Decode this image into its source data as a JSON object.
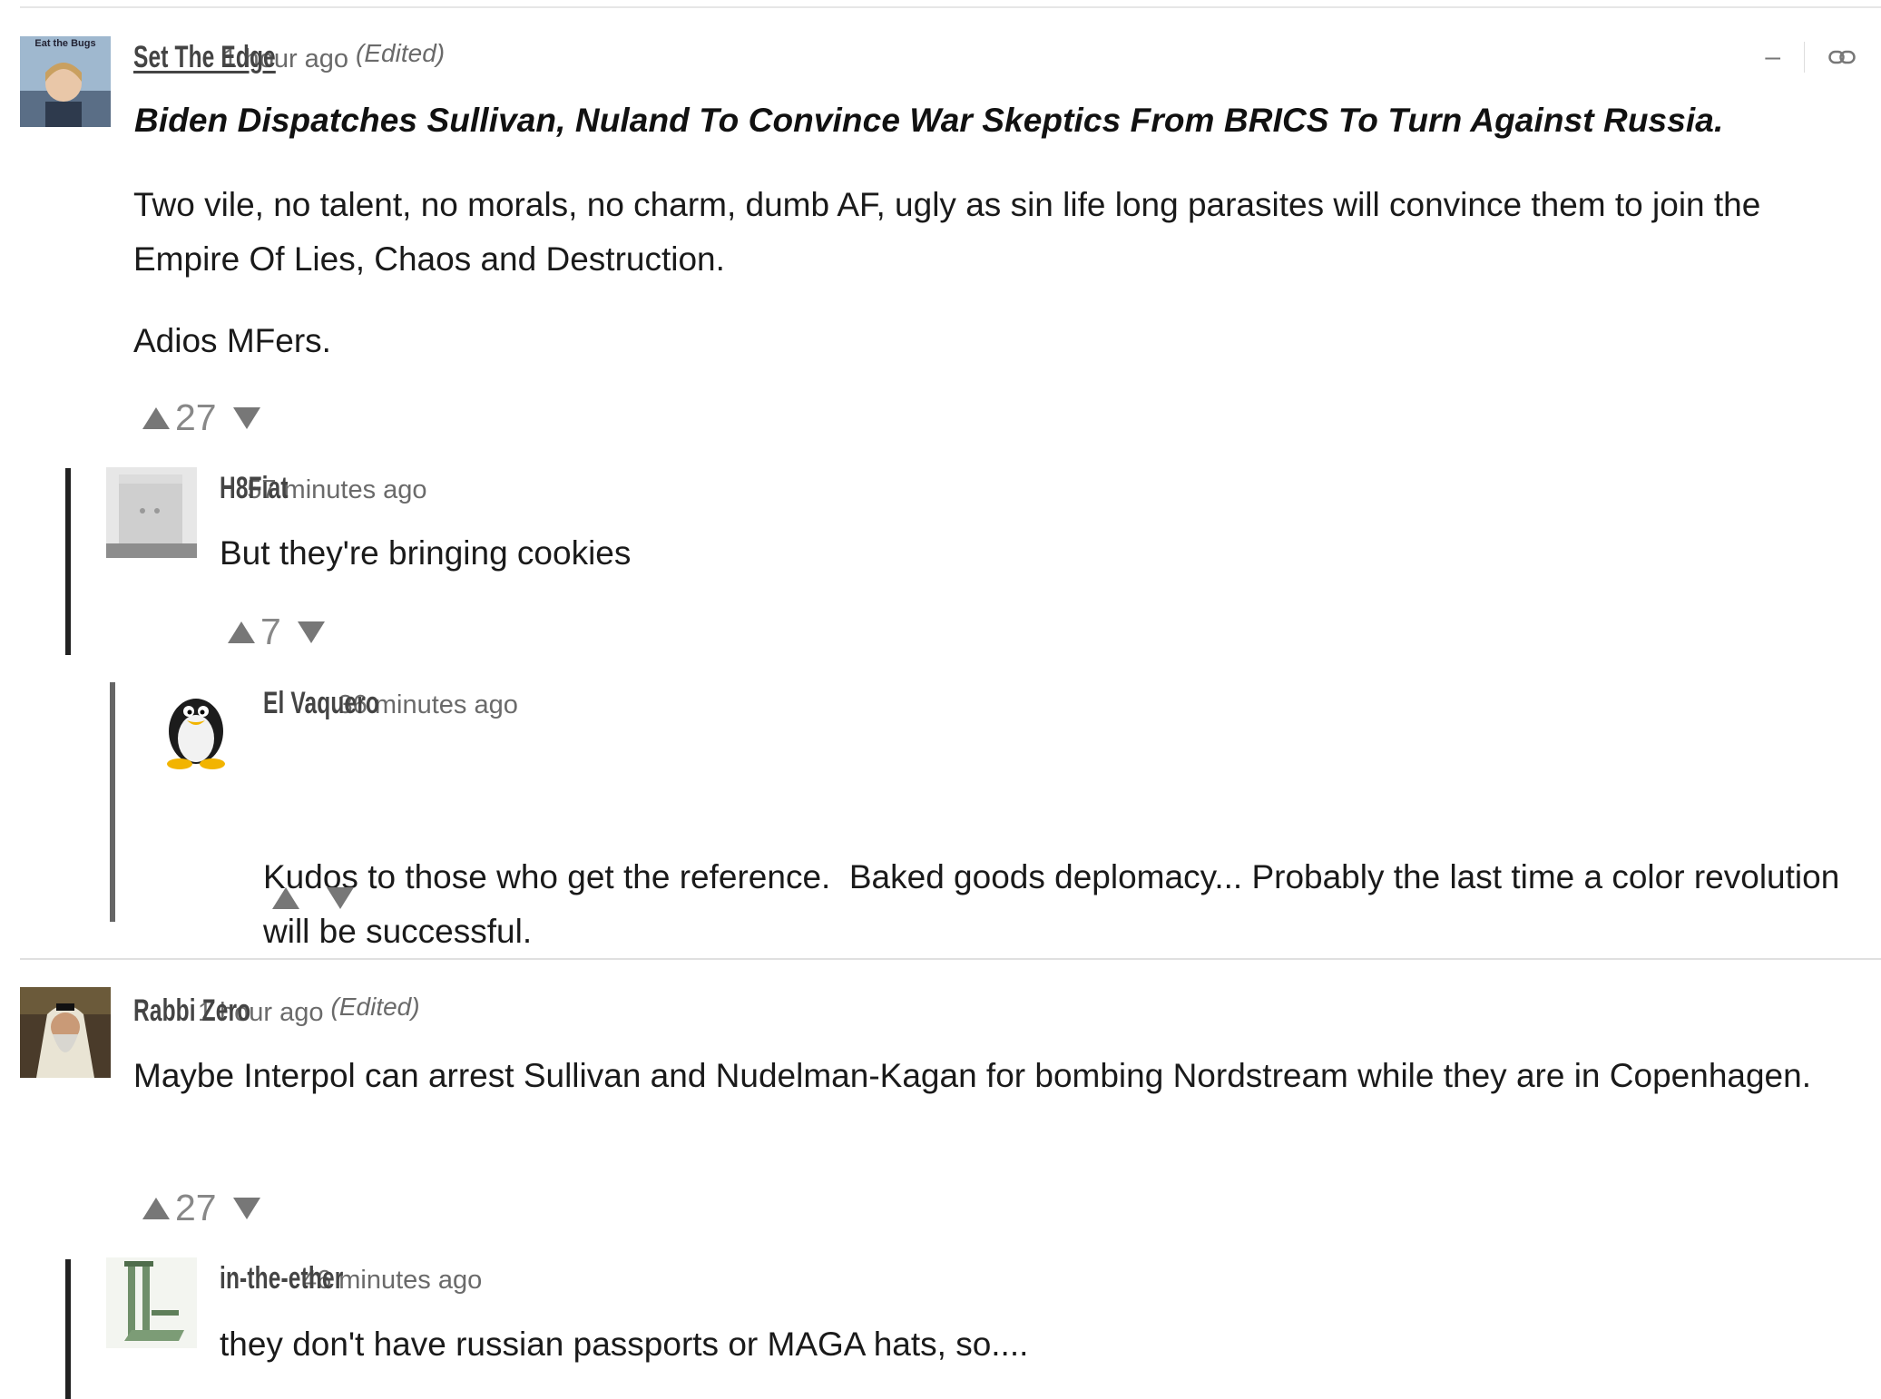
{
  "comments": [
    {
      "author": "Set The Edge",
      "time": "1 hour ago",
      "edited": "(Edited)",
      "avatar_text": "Eat the Bugs",
      "headline": "Biden Dispatches Sullivan, Nuland To Convince War Skeptics From BRICS To Turn Against Russia.",
      "body": [
        "Two vile, no talent, no morals, no charm, dumb AF, ugly as sin life long parasites will convince them to join the Empire Of Lies, Chaos and Destruction.",
        "Adios MFers."
      ],
      "votes": "27",
      "collapse": "–",
      "link_icon": "link-icon"
    },
    {
      "author": "H8Fiat",
      "time": "57 minutes ago",
      "body": [
        "But they're bringing cookies"
      ],
      "votes": "7"
    },
    {
      "author": "El Vaquero",
      "time": "36 minutes ago",
      "body": [
        "Kudos to those who get the reference.  Baked goods deplomacy... Probably the last time a color revolution will be successful."
      ],
      "votes": ""
    },
    {
      "author": "Rabbi Zero",
      "time": "1 hour ago",
      "edited": "(Edited)",
      "body": [
        "Maybe Interpol can arrest Sullivan and Nudelman-Kagan for bombing Nordstream while they are in Copenhagen."
      ],
      "votes": "27"
    },
    {
      "author": "in-the-ether",
      "time": "46 minutes ago",
      "body": [
        "they don't have russian passports or MAGA hats, so...."
      ]
    }
  ]
}
